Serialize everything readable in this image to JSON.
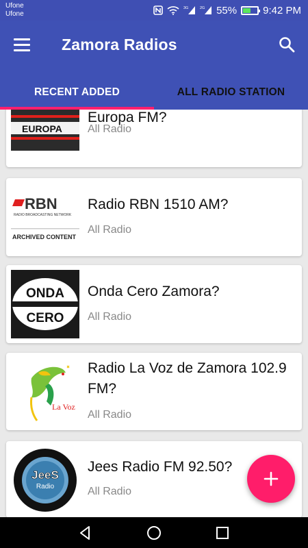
{
  "status_bar": {
    "carrier_1": "Ufone",
    "carrier_2": "Ufone",
    "network_1": "3G",
    "network_2": "2G",
    "battery": "55%",
    "battery_level": 0.55,
    "time": "9:42 PM"
  },
  "app_bar": {
    "title": "Zamora Radios",
    "menu_icon": "hamburger-menu-icon",
    "search_icon": "search-icon"
  },
  "tabs": [
    {
      "label": "RECENT ADDED",
      "active": true
    },
    {
      "label": "ALL RADIO STATION",
      "active": false
    }
  ],
  "stations": [
    {
      "title": "Europa FM?",
      "category": "All Radio",
      "logo": "europa-fm-logo",
      "logo_text": "EUROPA"
    },
    {
      "title": "Radio RBN 1510 AM?",
      "category": "All Radio",
      "logo": "rbn-logo",
      "logo_text": "RBN",
      "logo_subtext": "RADIO BROADCASTING NETWORK",
      "logo_caption": "ARCHIVED CONTENT"
    },
    {
      "title": "Onda Cero Zamora?",
      "category": "All Radio",
      "logo": "onda-cero-logo",
      "logo_line1": "ONDA",
      "logo_line2": "CERO"
    },
    {
      "title": "Radio La Voz de Zamora 102.9 FM?",
      "category": "All Radio",
      "logo": "la-voz-logo",
      "logo_text": "La Voz"
    },
    {
      "title": "Jees Radio FM 92.50?",
      "category": "All Radio",
      "logo": "jees-radio-logo",
      "logo_text": "JeeS",
      "logo_subtext": "Radio"
    }
  ],
  "fab": {
    "label": "+",
    "icon": "add-icon"
  },
  "nav": {
    "back_icon": "back-icon",
    "home_icon": "home-icon",
    "recents_icon": "recents-icon"
  },
  "colors": {
    "primary": "#3f51b5",
    "accent": "#ff1d6a",
    "status_bar": "#3f4fb3"
  }
}
